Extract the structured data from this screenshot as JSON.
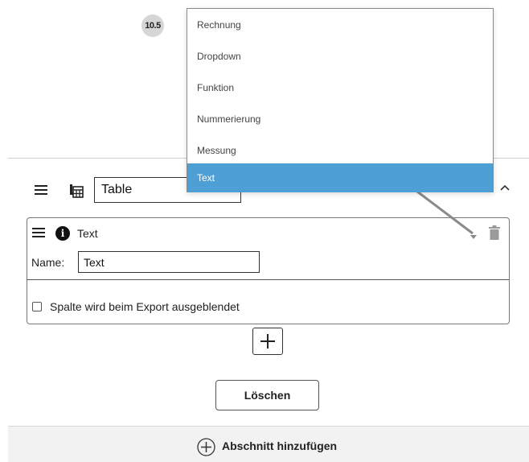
{
  "step_badge": "10.5",
  "dropdown": {
    "options": [
      "Rechnung",
      "Dropdown",
      "Funktion",
      "Nummerierung",
      "Messung",
      "Text"
    ],
    "selected_index": 5
  },
  "section": {
    "table_name_value": "Table"
  },
  "column_card": {
    "type_label": "Text",
    "name_label": "Name:",
    "name_value": "Text",
    "export_checkbox_label": "Spalte wird beim Export ausgeblendet",
    "export_checked": false
  },
  "actions": {
    "delete_label": "Löschen",
    "add_section_label": "Abschnitt hinzufügen"
  },
  "colors": {
    "selected_option_bg": "#4e9fd6",
    "footer_bg": "#f2f2f2"
  },
  "icons": [
    "drag-handle-icon",
    "table-icon",
    "chevron-up-icon",
    "info-icon",
    "caret-down-icon",
    "trash-icon",
    "plus-icon",
    "add-circle-icon"
  ]
}
